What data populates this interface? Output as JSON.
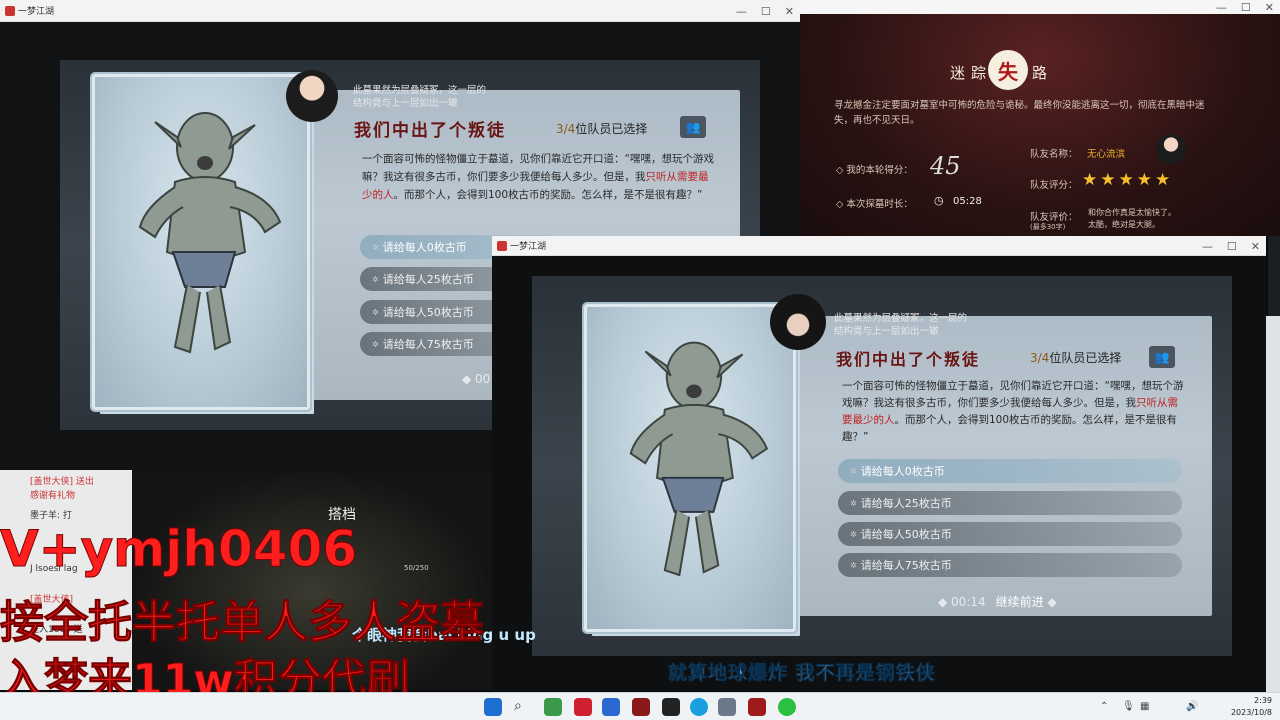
{
  "window_left": {
    "title": "一梦江湖",
    "min": "—",
    "max": "☐",
    "close": "✕"
  },
  "window_right": {
    "title": "一梦江湖",
    "min": "—",
    "max": "☐",
    "close": "✕"
  },
  "window_top_right_controls": {
    "min": "—",
    "max": "☐",
    "close": "✕"
  },
  "event": {
    "intro": [
      "此墓果然为层叠疑冢，这一层的",
      "结构竟与上一层如出一辙"
    ],
    "title": "我们中出了个叛徒",
    "member_selected": "3/4",
    "member_label": "位队员已选择",
    "dialogue_1": "一个面容可怖的怪物僵立于墓道，见你们靠近它开口道：“嘿嘿，想玩个游戏嘛？我这有很多古币，你们要多少我便给每人多少。但是，我",
    "dialogue_highlight": "只听从需要最少的人",
    "dialogue_2": "。而那个人，会得到100枚古币的奖励。怎么样，是不是很有趣？”",
    "options": [
      "请给每人0枚古币",
      "请给每人25枚古币",
      "请给每人50枚古币",
      "请给每人75枚古币"
    ],
    "timer": "00:14",
    "continue_label": "继续前进",
    "left_timer_partial": "00"
  },
  "result": {
    "title_left": "迷踪",
    "seal_char": "失",
    "title_right": "路",
    "description": "寻龙撼金注定要面对墓室中可怖的危险与诡秘。最终你没能逃离这一切，彻底在黑暗中迷失，再也不见天日。",
    "score_label": "我的本轮得分：",
    "score_value": "45",
    "time_label": "本次探墓时长：",
    "time_value": "05:28",
    "teammate_name_label": "队友名称：",
    "teammate_name": "无心流滨",
    "teammate_rating_label": "队友评分：",
    "teammate_rating": 5,
    "teammate_comment_label": "队友评价：",
    "teammate_comment_limit": "(最多30字)",
    "teammate_comment": [
      "和你合作真是太愉快了。",
      "太酷，绝对是大腿。"
    ]
  },
  "stream": {
    "chat_lines": [
      "[盖世大侠] 送出",
      "感谢有礼物",
      "墨子羊: 打",
      "J lsoesi lag",
      "[盖世大侠]",
      "进入1605 送"
    ],
    "mini_game_title": "搭档",
    "mini_game_progress": "50/250",
    "overlay_line1": "V+ymjh0406",
    "overlay_line2": "接全托半托单人多人盗墓",
    "overlay_line3": "入梦来11w积分代刷",
    "bottom_caption_partial": "个眼神我会backing u up",
    "lyric": "就算地球爆炸  我不再是钢铁侠"
  },
  "taskbar": {
    "time": "2:39",
    "date": "2023/10/8"
  },
  "colors": {
    "title_red": "#6b1414",
    "highlight_red": "#c02020",
    "star_gold": "#f5c030",
    "overlay_red": "#ff1e1e",
    "lyric_blue": "#bfe8ff"
  }
}
